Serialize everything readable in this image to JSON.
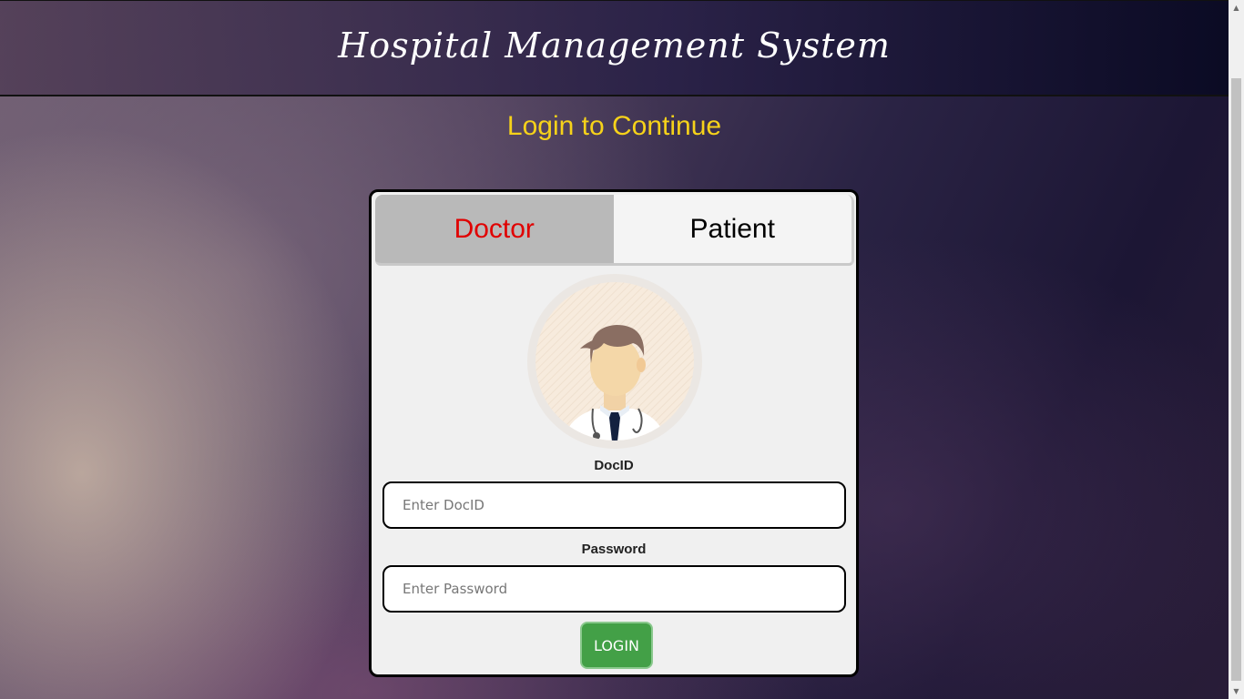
{
  "header": {
    "title": "Hospital Management System"
  },
  "subtitle": "Login to Continue",
  "tabs": [
    {
      "label": "Doctor",
      "active": true
    },
    {
      "label": "Patient",
      "active": false
    }
  ],
  "form": {
    "docid_label": "DocID",
    "docid_placeholder": "Enter DocID",
    "password_label": "Password",
    "password_placeholder": "Enter Password",
    "login_label": "LOGIN"
  },
  "colors": {
    "subtitle": "#f6d21a",
    "active_tab_text": "#e00000",
    "login_button": "#43a047"
  },
  "icons": {
    "avatar": "doctor-avatar-icon"
  }
}
